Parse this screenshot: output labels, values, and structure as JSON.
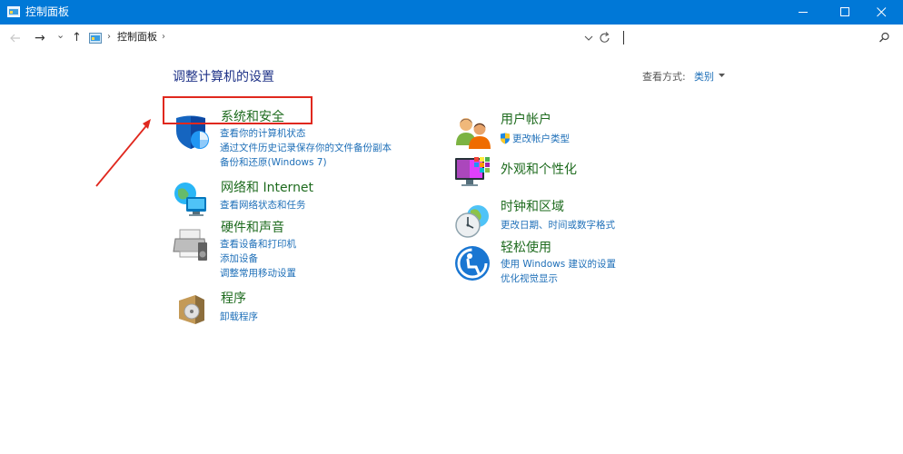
{
  "window": {
    "title": "控制面板",
    "icons": {
      "app": "control-panel-icon",
      "minimize": "minimize-icon",
      "maximize": "maximize-icon",
      "close": "close-icon"
    }
  },
  "address": {
    "back_icon": "back-arrow-icon",
    "forward_glyph": "→",
    "recent_glyph": "⌄",
    "up_glyph": "↑",
    "breadcrumb": "控制面板",
    "separator": "›",
    "search_placeholder": ""
  },
  "content": {
    "heading": "调整计算机的设置",
    "view_by_label": "查看方式:",
    "view_by_value": "类别",
    "left_categories": [
      {
        "title": "系统和安全",
        "icon": "shield-icon",
        "links": [
          "查看你的计算机状态",
          "通过文件历史记录保存你的文件备份副本",
          "备份和还原(Windows 7)"
        ]
      },
      {
        "title": "网络和 Internet",
        "icon": "network-globe-icon",
        "links": [
          "查看网络状态和任务"
        ]
      },
      {
        "title": "硬件和声音",
        "icon": "printer-speaker-icon",
        "links": [
          "查看设备和打印机",
          "添加设备",
          "调整常用移动设置"
        ]
      },
      {
        "title": "程序",
        "icon": "programs-disc-icon",
        "links": [
          "卸载程序"
        ]
      }
    ],
    "right_categories": [
      {
        "title": "用户帐户",
        "icon": "users-icon",
        "links": [
          "更改帐户类型"
        ]
      },
      {
        "title": "外观和个性化",
        "icon": "monitor-palette-icon",
        "links": []
      },
      {
        "title": "时钟和区域",
        "icon": "clock-globe-icon",
        "links": [
          "更改日期、时间或数字格式"
        ]
      },
      {
        "title": "轻松使用",
        "icon": "ease-of-access-icon",
        "links": [
          "使用 Windows 建议的设置",
          "优化视觉显示"
        ]
      }
    ]
  },
  "colors": {
    "titlebar": "#0078d7",
    "category_title": "#1e6b1e",
    "link": "#1e6fb8",
    "annotation": "#e0281e"
  }
}
